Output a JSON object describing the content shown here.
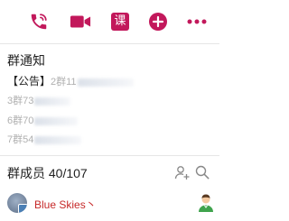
{
  "toolbar": {
    "call_icon": "phone-icon",
    "video_icon": "video-camera-icon",
    "class_label": "课",
    "add_icon": "plus-circle-icon",
    "more_icon": "more-dots-icon",
    "accent_color": "#c2185b"
  },
  "notice": {
    "title": "群通知",
    "lines": [
      {
        "tag": "【公告】",
        "text": "2群11"
      },
      {
        "tag": "",
        "text": "3群73"
      },
      {
        "tag": "",
        "text": "6群70"
      },
      {
        "tag": "",
        "text": "7群54"
      }
    ]
  },
  "members": {
    "title": "群成员 40/107",
    "add_icon": "add-member-icon",
    "search_icon": "search-icon",
    "list": [
      {
        "name": "Blue Skies丶",
        "name_color": "#c62828",
        "role_icon": "group-owner-icon"
      }
    ]
  }
}
